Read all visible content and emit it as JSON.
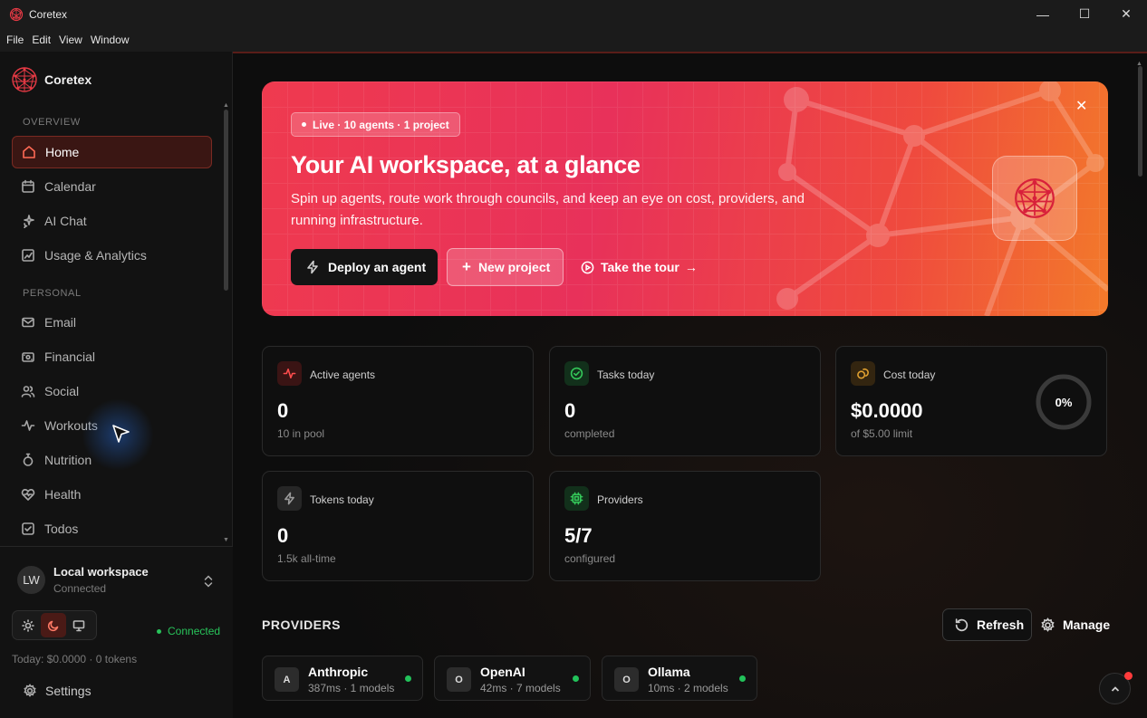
{
  "window": {
    "title": "Coretex",
    "menu": [
      "File",
      "Edit",
      "View",
      "Window"
    ],
    "controls": {
      "minimize": "—",
      "maximize": "☐",
      "close": "✕"
    }
  },
  "brand": {
    "name": "Coretex",
    "accent": "#e83a45"
  },
  "sidebar": {
    "overview_label": "OVERVIEW",
    "personal_label": "PERSONAL",
    "items": [
      {
        "label": "Home",
        "icon": "home-icon"
      },
      {
        "label": "Calendar",
        "icon": "calendar-icon"
      },
      {
        "label": "AI Chat",
        "icon": "sparkle-icon"
      },
      {
        "label": "Usage & Analytics",
        "icon": "chart-icon"
      },
      {
        "label": "Email",
        "icon": "mail-icon"
      },
      {
        "label": "Financial",
        "icon": "wallet-icon"
      },
      {
        "label": "Social",
        "icon": "users-icon"
      },
      {
        "label": "Workouts",
        "icon": "activity-icon"
      },
      {
        "label": "Nutrition",
        "icon": "apple-icon"
      },
      {
        "label": "Health",
        "icon": "heart-icon"
      },
      {
        "label": "Todos",
        "icon": "checkbox-icon"
      }
    ],
    "workspace": {
      "initials": "LW",
      "name": "Local workspace",
      "status": "Connected"
    },
    "connection": "Connected",
    "today": "Today: $0.0000 · 0 tokens",
    "settings_label": "Settings"
  },
  "hero": {
    "badge": "Live · 10 agents · 1 project",
    "title": "Your AI workspace, at a glance",
    "subtitle": "Spin up agents, route work through councils, and keep an eye on cost, providers, and running infrastructure.",
    "deploy_label": "Deploy an agent",
    "new_project_label": "New project",
    "tour_label": "Take the tour",
    "close": "✕"
  },
  "stats": [
    {
      "label": "Active agents",
      "value": "0",
      "sub": "10 in pool",
      "icon": "pulse-icon",
      "color": "#ff4d4d"
    },
    {
      "label": "Tasks today",
      "value": "0",
      "sub": "completed",
      "icon": "check-circle-icon",
      "color": "#34c759"
    },
    {
      "label": "Cost today",
      "value": "$0.0000",
      "sub": "of $5.00 limit",
      "icon": "coins-icon",
      "color": "#e0a030",
      "ring": "0%",
      "ring_value": 0
    },
    {
      "label": "Tokens today",
      "value": "0",
      "sub": "1.5k all-time",
      "icon": "bolt-icon",
      "color": "#9a9a9a"
    },
    {
      "label": "Providers",
      "value": "5/7",
      "sub": "configured",
      "icon": "chip-icon",
      "color": "#34c759"
    }
  ],
  "providers": {
    "heading": "PROVIDERS",
    "refresh_label": "Refresh",
    "manage_label": "Manage",
    "items": [
      {
        "initial": "A",
        "name": "Anthropic",
        "meta": "387ms · 1 models"
      },
      {
        "initial": "O",
        "name": "OpenAI",
        "meta": "42ms · 7 models"
      },
      {
        "initial": "O",
        "name": "Ollama",
        "meta": "10ms · 2 models"
      }
    ]
  }
}
